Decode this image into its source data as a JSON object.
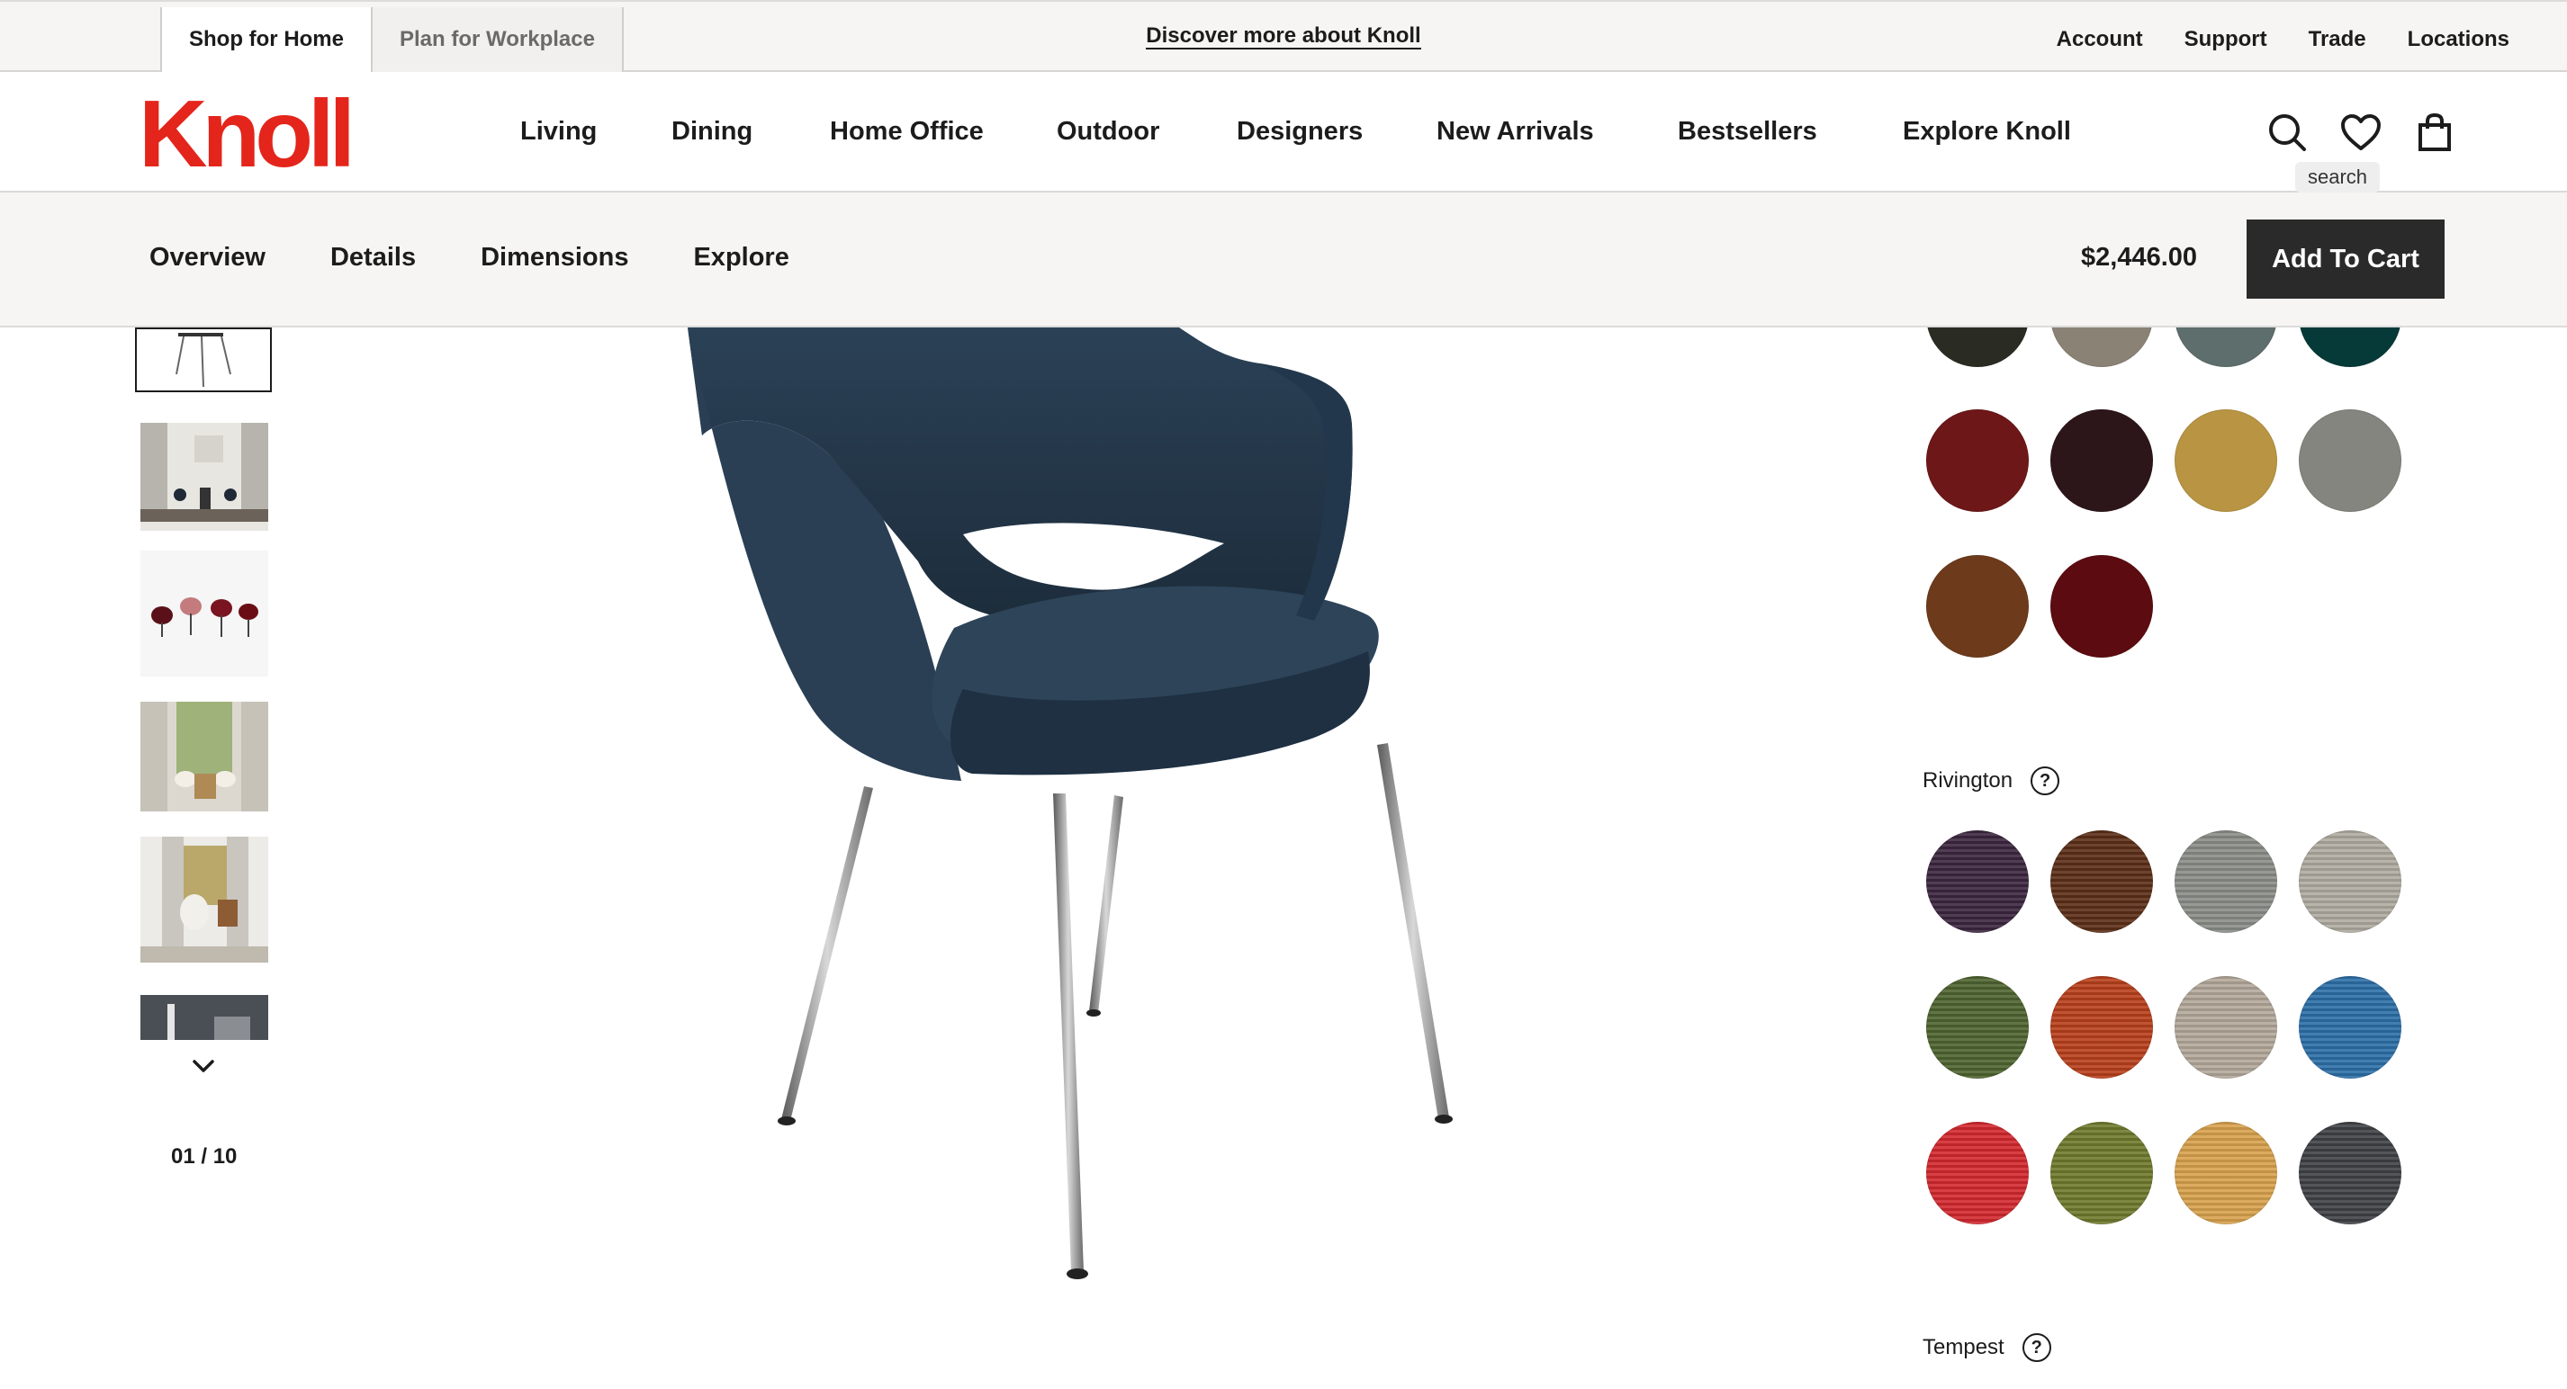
{
  "utility_bar": {
    "tabs": [
      "Shop for Home",
      "Plan for Workplace"
    ],
    "center_link": "Discover more about Knoll",
    "links": [
      "Account",
      "Support",
      "Trade",
      "Locations"
    ]
  },
  "header": {
    "logo": "Knoll",
    "nav": [
      "Living",
      "Dining",
      "Home Office",
      "Outdoor",
      "Designers",
      "New Arrivals",
      "Bestsellers",
      "Explore Knoll"
    ],
    "icons": [
      "search-icon",
      "heart-icon",
      "bag-icon"
    ],
    "tooltip": "search"
  },
  "product_bar": {
    "tabs": [
      "Overview",
      "Details",
      "Dimensions",
      "Explore"
    ],
    "price": "$2,446.00",
    "add_to_cart": "Add To Cart"
  },
  "gallery": {
    "counter": "01 / 10",
    "thumbnail_count_visible": 6
  },
  "swatches": {
    "upper_group": [
      "#2a2b22",
      "#8a8275",
      "#5d6e6c",
      "#053a38",
      "#6e1718",
      "#2d1619",
      "#b89443",
      "#85857f",
      "#6d3b1c",
      "#5c0c10"
    ],
    "rivington": {
      "label": "Rivington",
      "colors": [
        "#3c2740",
        "#5b2f19",
        "#8b8f88",
        "#b1aca1",
        "#4f6430",
        "#b8401c",
        "#b3a89b",
        "#2e6fa8",
        "#d2292f",
        "#6f7a2e",
        "#d8a24e",
        "#3f4246"
      ]
    },
    "tempest": {
      "label": "Tempest"
    }
  },
  "colors": {
    "brand": "#e4251b",
    "button_bg": "#2a2a2a",
    "chair_fabric": "#263a4c"
  }
}
